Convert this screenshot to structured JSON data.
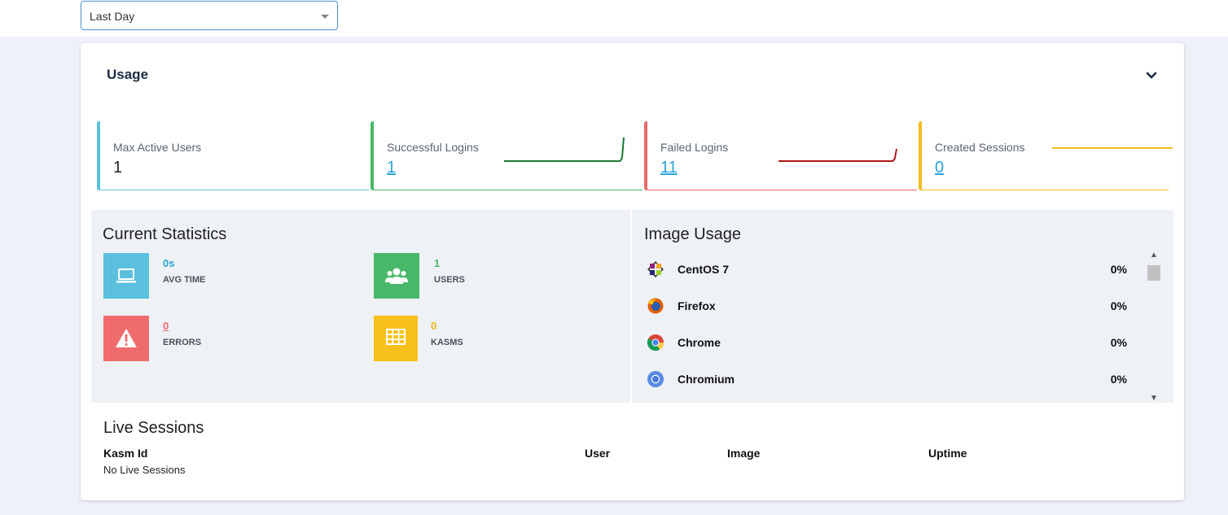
{
  "filter": {
    "range_value": "Last Day"
  },
  "usage": {
    "title": "Usage",
    "stats": [
      {
        "label": "Max Active Users",
        "value": "1",
        "color": "#5bc0de"
      },
      {
        "label": "Successful Logins",
        "value": "1",
        "color": "#4ab86a",
        "sparkline_color": "#1c7a33"
      },
      {
        "label": "Failed Logins",
        "value": "11",
        "color": "#e96a6a",
        "sparkline_color": "#b01818"
      },
      {
        "label": "Created Sessions",
        "value": "0",
        "color": "#f0bd1b",
        "sparkline_color": "#f0bd1b"
      }
    ]
  },
  "current_statistics": {
    "title": "Current Statistics",
    "tiles": [
      {
        "value": "0s",
        "label": "AVG TIME",
        "icon": "laptop-icon",
        "color": "#5bc0de",
        "value_color": "#2aa3d6"
      },
      {
        "value": "1",
        "label": "USERS",
        "icon": "users-icon",
        "color": "#4ab86a",
        "value_color": "#4ab86a"
      },
      {
        "value": "0",
        "label": "ERRORS",
        "icon": "warning-icon",
        "color": "#f06c6c",
        "value_color": "#f06c6c"
      },
      {
        "value": "0",
        "label": "KASMS",
        "icon": "grid-icon",
        "color": "#f7c01a",
        "value_color": "#f0b41a"
      }
    ]
  },
  "image_usage": {
    "title": "Image Usage",
    "items": [
      {
        "name": "CentOS 7",
        "percent": "0%",
        "icon": "centos-logo-icon"
      },
      {
        "name": "Firefox",
        "percent": "0%",
        "icon": "firefox-logo-icon"
      },
      {
        "name": "Chrome",
        "percent": "0%",
        "icon": "chrome-logo-icon"
      },
      {
        "name": "Chromium",
        "percent": "0%",
        "icon": "chromium-logo-icon"
      }
    ]
  },
  "live_sessions": {
    "title": "Live Sessions",
    "columns": [
      "Kasm Id",
      "User",
      "Image",
      "Uptime"
    ],
    "empty_text": "No Live Sessions"
  }
}
